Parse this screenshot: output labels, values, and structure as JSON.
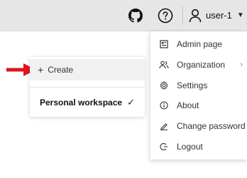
{
  "topbar": {
    "user_name": "user-1"
  },
  "create_popover": {
    "create_label": "Create",
    "workspace_label": "Personal workspace",
    "checkmark": "✓"
  },
  "user_menu": {
    "items": [
      {
        "label": "Admin page",
        "icon": "admin-icon"
      },
      {
        "label": "Organization",
        "icon": "organization-icon"
      },
      {
        "label": "Settings",
        "icon": "settings-icon"
      },
      {
        "label": "About",
        "icon": "info-icon"
      },
      {
        "label": "Change password",
        "icon": "edit-icon"
      },
      {
        "label": "Logout",
        "icon": "logout-icon"
      }
    ]
  },
  "colors": {
    "annotation_arrow": "#e0141c",
    "topbar_bg": "#e6e6e6"
  }
}
